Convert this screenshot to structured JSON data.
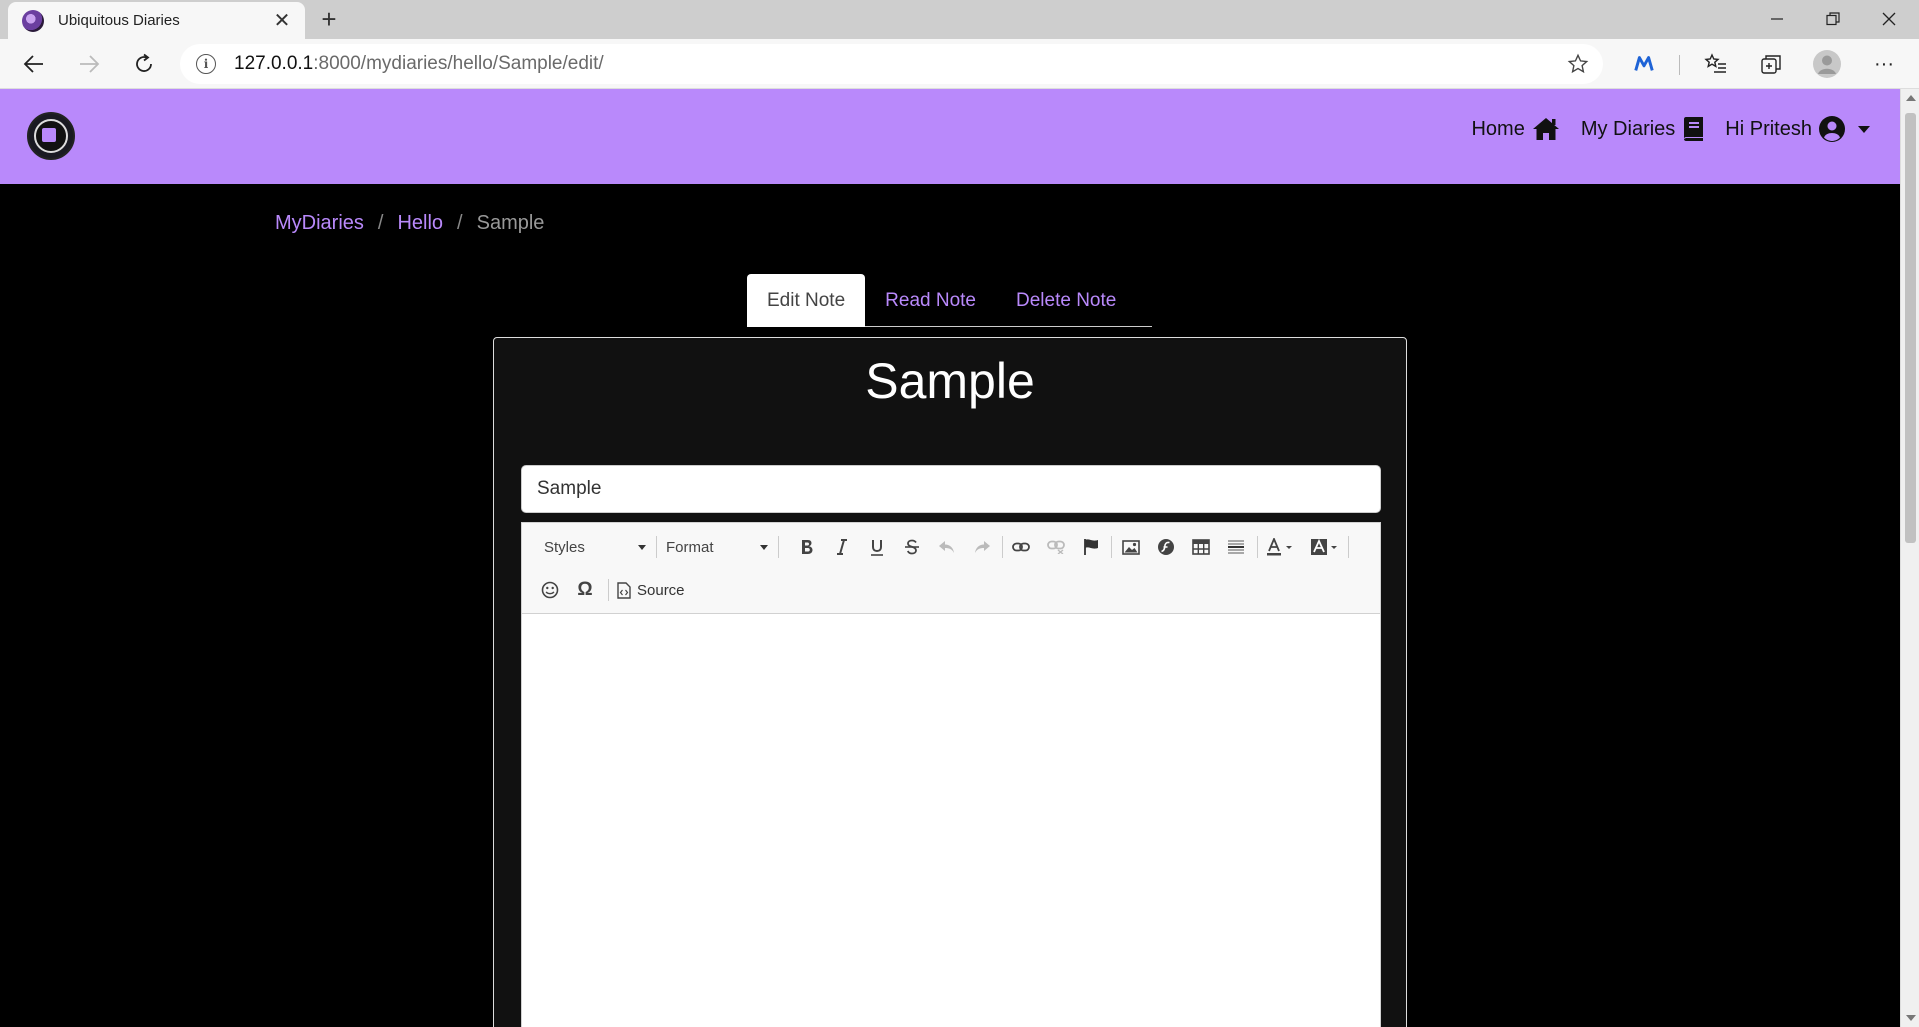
{
  "browser": {
    "tab_title": "Ubiquitous Diaries",
    "tab_close": "✕",
    "new_tab": "+",
    "address_host": "127.0.0.1",
    "address_path": ":8000/mydiaries/hello/Sample/edit/",
    "more_menu": "···"
  },
  "navbar": {
    "home_label": "Home",
    "diaries_label": "My Diaries",
    "user_label": "Hi Pritesh"
  },
  "breadcrumb": {
    "items": [
      "MyDiaries",
      "Hello",
      "Sample"
    ],
    "separator": "/"
  },
  "tabs": {
    "edit": "Edit Note",
    "read": "Read Note",
    "delete": "Delete Note"
  },
  "note": {
    "heading": "Sample",
    "title_value": "Sample"
  },
  "editor": {
    "styles_label": "Styles",
    "format_label": "Format",
    "source_label": "Source"
  },
  "colors": {
    "brand": "#b989fb",
    "page_bg": "#000000",
    "card_bg": "#111111"
  }
}
